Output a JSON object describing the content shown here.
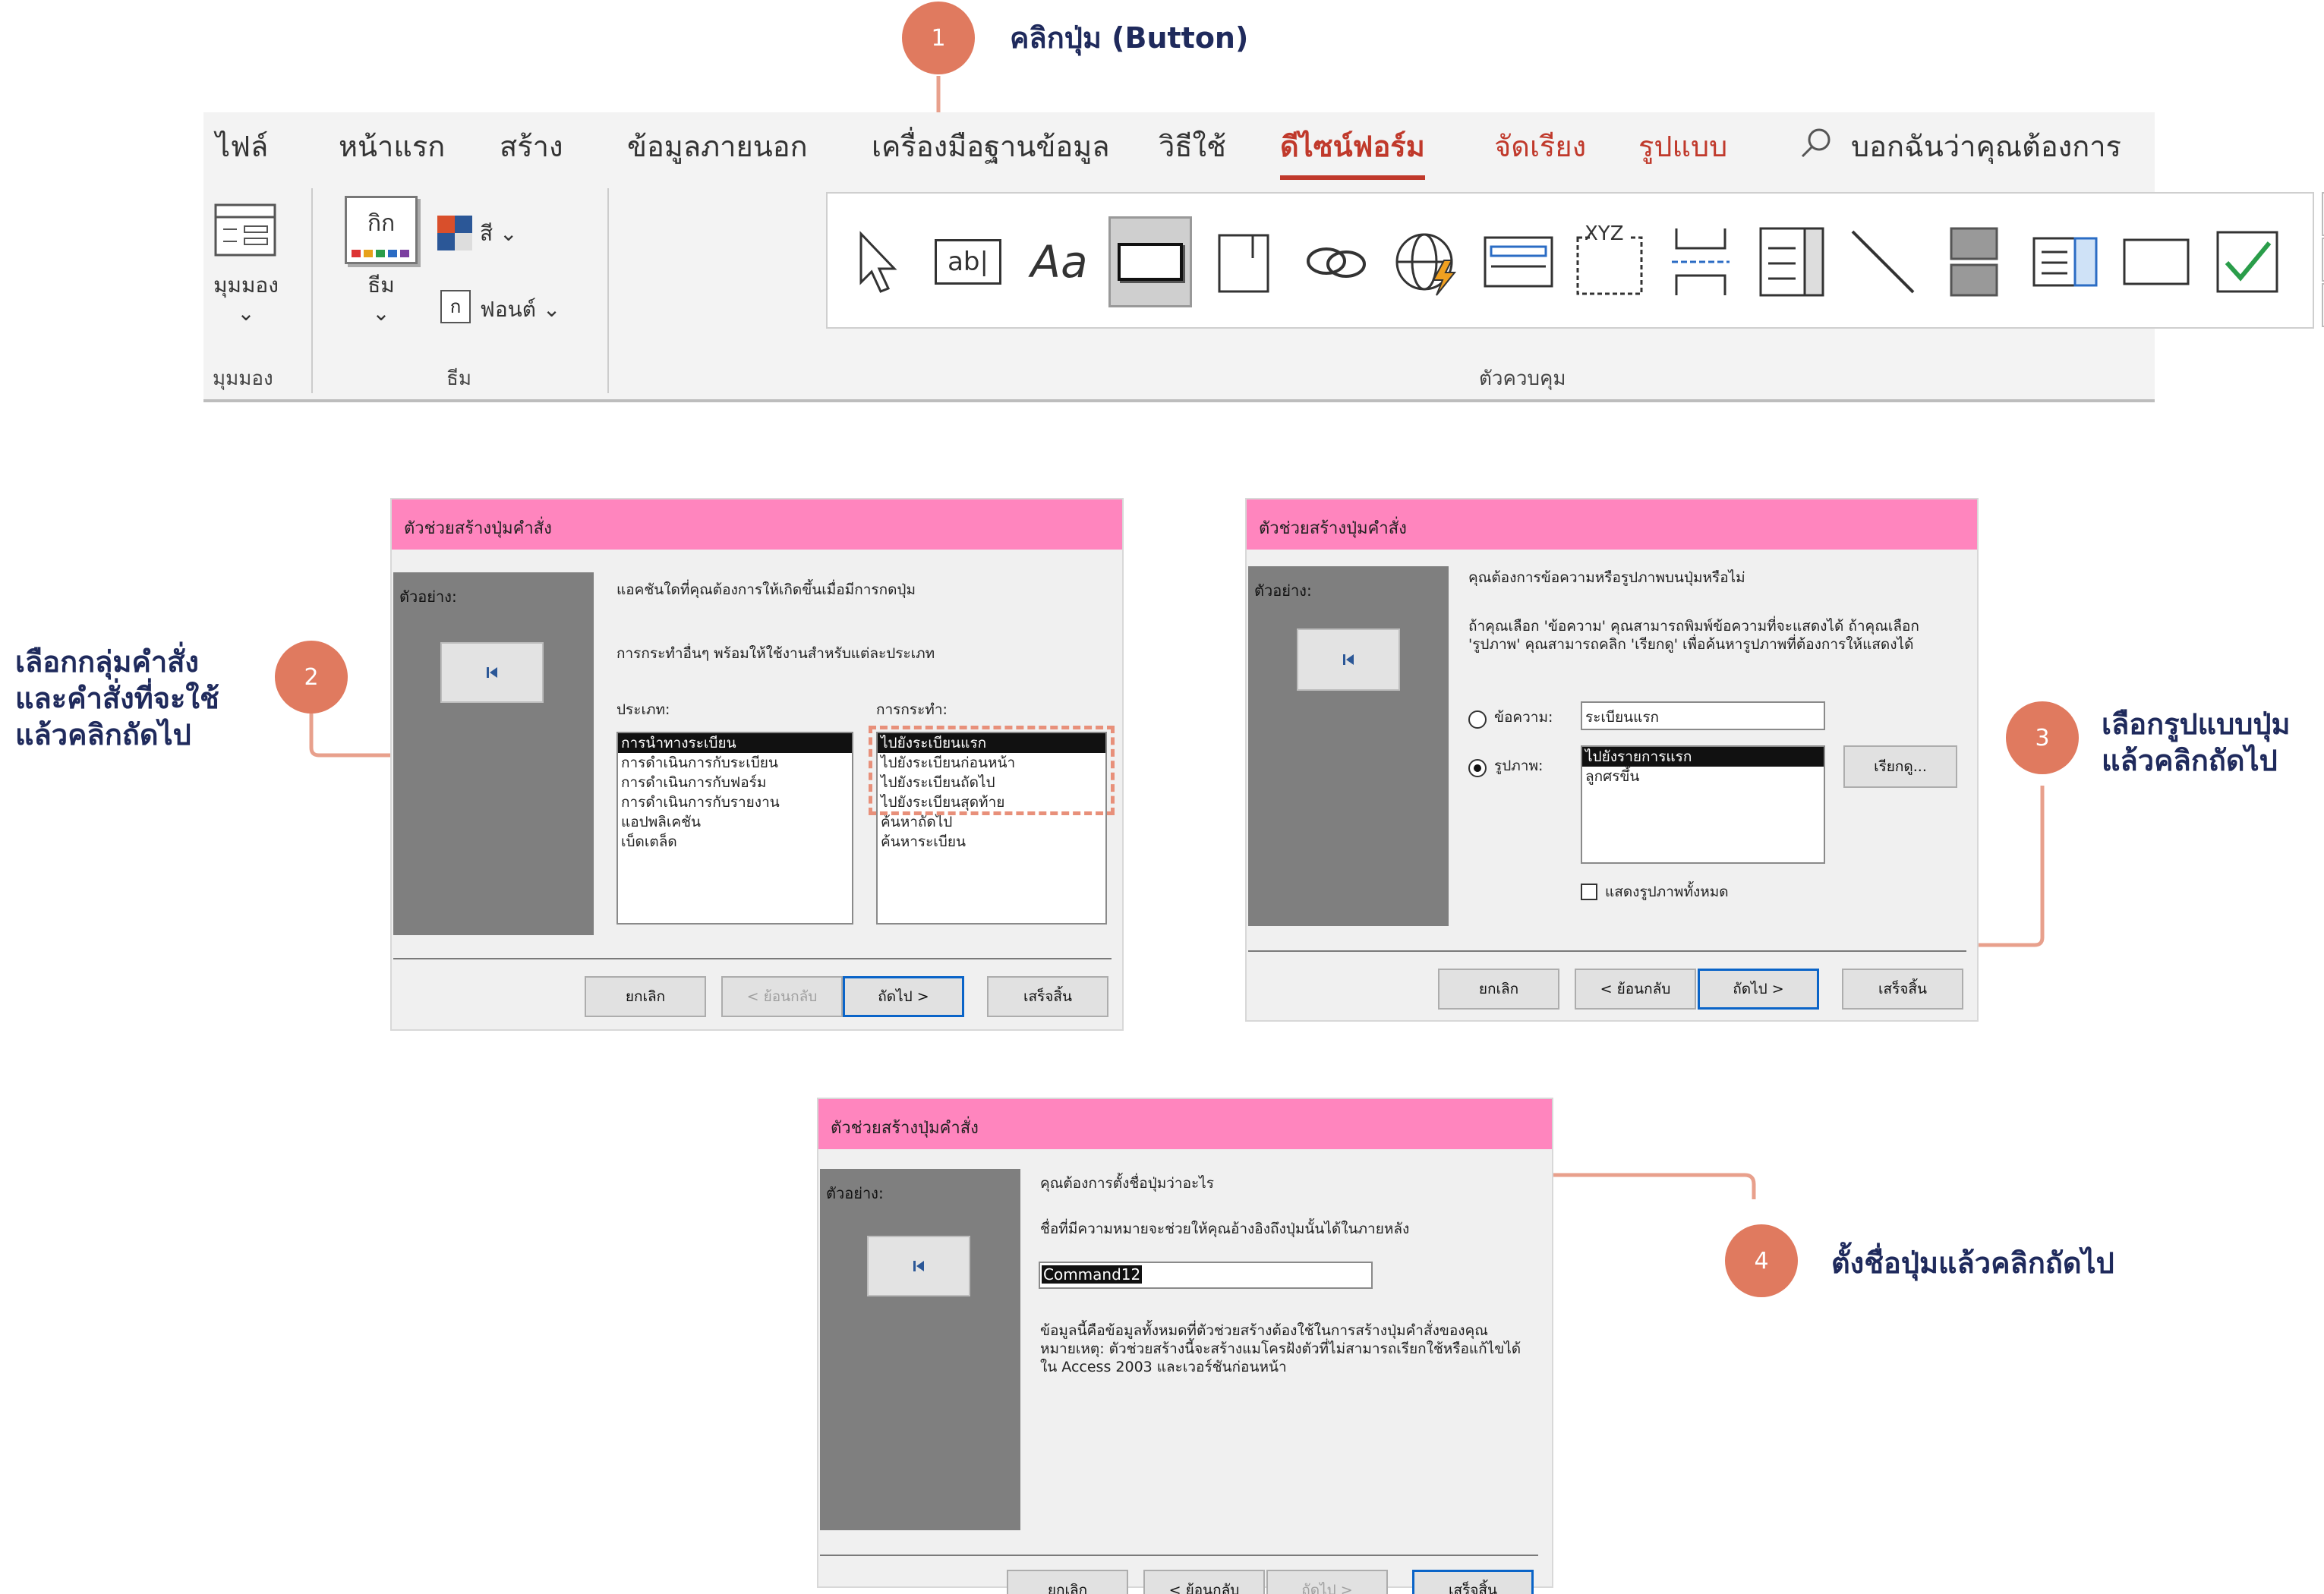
{
  "steps": [
    {
      "number": "1",
      "text": "คลิกปุ่ม (Button)"
    },
    {
      "number": "2",
      "text": "เลือกกลุ่มคำสั่ง\nและคำสั่งที่จะใช้\nแล้วคลิกถัดไป"
    },
    {
      "number": "3",
      "text": "เลือกรูปแบบปุ่ม\nแล้วคลิกถัดไป"
    },
    {
      "number": "4",
      "text": "ตั้งชื่อปุ่มแล้วคลิกถัดไป"
    }
  ],
  "ribbon": {
    "tabs": [
      "ไฟล์",
      "หน้าแรก",
      "สร้าง",
      "ข้อมูลภายนอก",
      "เครื่องมือฐานข้อมูล",
      "วิธีใช้",
      "ดีไซน์ฟอร์ม",
      "จัดเรียง",
      "รูปแบบ"
    ],
    "active_tab": "ดีไซน์ฟอร์ม",
    "search_placeholder": "บอกฉันว่าคุณต้องการ",
    "view_button": "มุมมอง",
    "view_group": "มุมมอง",
    "theme_button": "ธีม",
    "theme_group": "ธีม",
    "theme_thumb": "กิก",
    "colors_button": "สี",
    "fonts_button": "ฟอนต์",
    "fonts_glyph": "ก",
    "controls_group": "ตัวควบคุม",
    "textbox_glyph": "ab|",
    "label_glyph": "Aa",
    "xyz_glyph": "XYZ",
    "controls": [
      "select-icon",
      "textbox-icon",
      "label-icon",
      "button-icon",
      "tab-control-icon",
      "hyperlink-icon",
      "web-browser-icon",
      "navigation-icon",
      "option-group-icon",
      "page-break-icon",
      "combo-box-icon",
      "line-icon",
      "toggle-icon",
      "list-box-icon",
      "rectangle-icon",
      "checkbox-icon"
    ]
  },
  "dialog1": {
    "title": "ตัวช่วยสร้างปุ่มคำสั่ง",
    "preview_label": "ตัวอย่าง:",
    "prompt": "แอคชันใดที่คุณต้องการให้เกิดขึ้นเมื่อมีการกดปุ่ม",
    "hint": "การกระทำอื่นๆ พร้อมให้ใช้งานสำหรับแต่ละประเภท",
    "categories_label": "ประเภท:",
    "actions_label": "การกระทำ:",
    "categories": [
      "การนำทางระเบียน",
      "การดำเนินการกับระเบียน",
      "การดำเนินการกับฟอร์ม",
      "การดำเนินการกับรายงาน",
      "แอปพลิเคชัน",
      "เบ็ดเตล็ด"
    ],
    "actions": [
      "ไปยังระเบียนแรก",
      "ไปยังระเบียนก่อนหน้า",
      "ไปยังระเบียนถัดไป",
      "ไปยังระเบียนสุดท้าย",
      "ค้นหาถัดไป",
      "ค้นหาระเบียน"
    ],
    "buttons": {
      "cancel": "ยกเลิก",
      "back": "< ย้อนกลับ",
      "next": "ถัดไป >",
      "finish": "เสร็จสิ้น"
    }
  },
  "dialog2": {
    "title": "ตัวช่วยสร้างปุ่มคำสั่ง",
    "preview_label": "ตัวอย่าง:",
    "prompt": "คุณต้องการข้อความหรือรูปภาพบนปุ่มหรือไม่",
    "hint1": "ถ้าคุณเลือก 'ข้อความ' คุณสามารถพิมพ์ข้อความที่จะแสดงได้ ถ้าคุณเลือก",
    "hint2": "'รูปภาพ' คุณสามารถคลิก 'เรียกดู' เพื่อค้นหารูปภาพที่ต้องการให้แสดงได้",
    "text_option": "ข้อความ:",
    "text_value": "ระเบียนแรก",
    "picture_option": "รูปภาพ:",
    "pictures": [
      "ไปยังรายการแรก",
      "ลูกศรขึ้น"
    ],
    "browse": "เรียกดู...",
    "show_all": "แสดงรูปภาพทั้งหมด",
    "buttons": {
      "cancel": "ยกเลิก",
      "back": "< ย้อนกลับ",
      "next": "ถัดไป >",
      "finish": "เสร็จสิ้น"
    }
  },
  "dialog3": {
    "title": "ตัวช่วยสร้างปุ่มคำสั่ง",
    "preview_label": "ตัวอย่าง:",
    "prompt": "คุณต้องการตั้งชื่อปุ่มว่าอะไร",
    "hint": "ชื่อที่มีความหมายจะช่วยให้คุณอ้างอิงถึงปุ่มนั้นได้ในภายหลัง",
    "name_value": "Command12",
    "info1": "ข้อมูลนี้คือข้อมูลทั้งหมดที่ตัวช่วยสร้างต้องใช้ในการสร้างปุ่มคำสั่งของคุณ",
    "info2": "หมายเหตุ: ตัวช่วยสร้างนี้จะสร้างแมโครฝังตัวที่ไม่สามารถเรียกใช้หรือแก้ไขได้",
    "info3": "ใน Access 2003 และเวอร์ชันก่อนหน้า",
    "buttons": {
      "cancel": "ยกเลิก",
      "back": "< ย้อนกลับ",
      "next": "ถัดไป >",
      "finish": "เสร็จสิ้น"
    }
  },
  "colors": {
    "accent": "#e07a5f",
    "title_bar": "#ff85be",
    "callout_text": "#1f2a5c",
    "active_tab": "#c0392b"
  }
}
